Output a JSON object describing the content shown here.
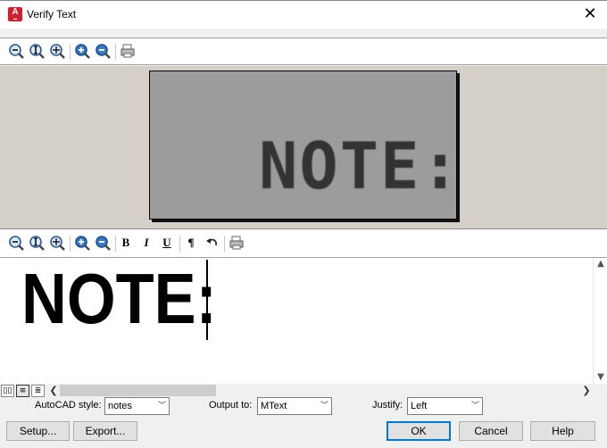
{
  "window": {
    "title": "Verify Text",
    "app_badge": "A"
  },
  "preview": {
    "recognized_image_text": "NOTE:"
  },
  "editor": {
    "text": "NOTE:"
  },
  "view_buttons": [
    "▯▯",
    "≡",
    "≣"
  ],
  "options": {
    "style_label": "AutoCAD style:",
    "style_value": "notes",
    "output_label": "Output to:",
    "output_value": "MText",
    "justify_label": "Justify:",
    "justify_value": "Left"
  },
  "buttons": {
    "setup": "Setup...",
    "export": "Export...",
    "ok": "OK",
    "cancel": "Cancel",
    "help": "Help"
  },
  "format_labels": {
    "bold": "B",
    "italic": "I",
    "underline": "U",
    "paragraph": "¶"
  },
  "colors": {
    "preview_bg": "#9c9c9c",
    "panel_bg": "#d4d0c8",
    "default_button_border": "#0078d7",
    "app_icon": "#d31f2c"
  }
}
